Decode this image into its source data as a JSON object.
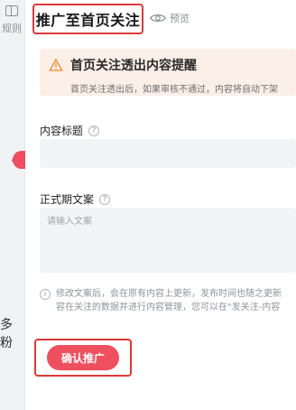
{
  "left": {
    "top_text": "规则",
    "arrow": "←",
    "bottom_text": "多粉"
  },
  "header": {
    "title": "推广至首页关注",
    "preview_label": "预览"
  },
  "notice": {
    "title": "首页关注透出内容提醒",
    "desc": "首页关注透出后，如果审核不通过，内容将自动下架"
  },
  "form": {
    "title_label": "内容标题",
    "copy_label": "正式期文案",
    "copy_placeholder": "请输入文案"
  },
  "tip": {
    "line1": "修改文案后，会在原有内容上更新，发布时间也随之更新",
    "line2": "容在关注的数据并进行内容管理，您可以在\"发关注-内容"
  },
  "actions": {
    "confirm_label": "确认推广"
  },
  "colors": {
    "highlight_red": "#d93a3a",
    "primary_button": "#ef5060",
    "notice_bg": "#fcefe7",
    "warn_orange": "#f08a2b"
  }
}
